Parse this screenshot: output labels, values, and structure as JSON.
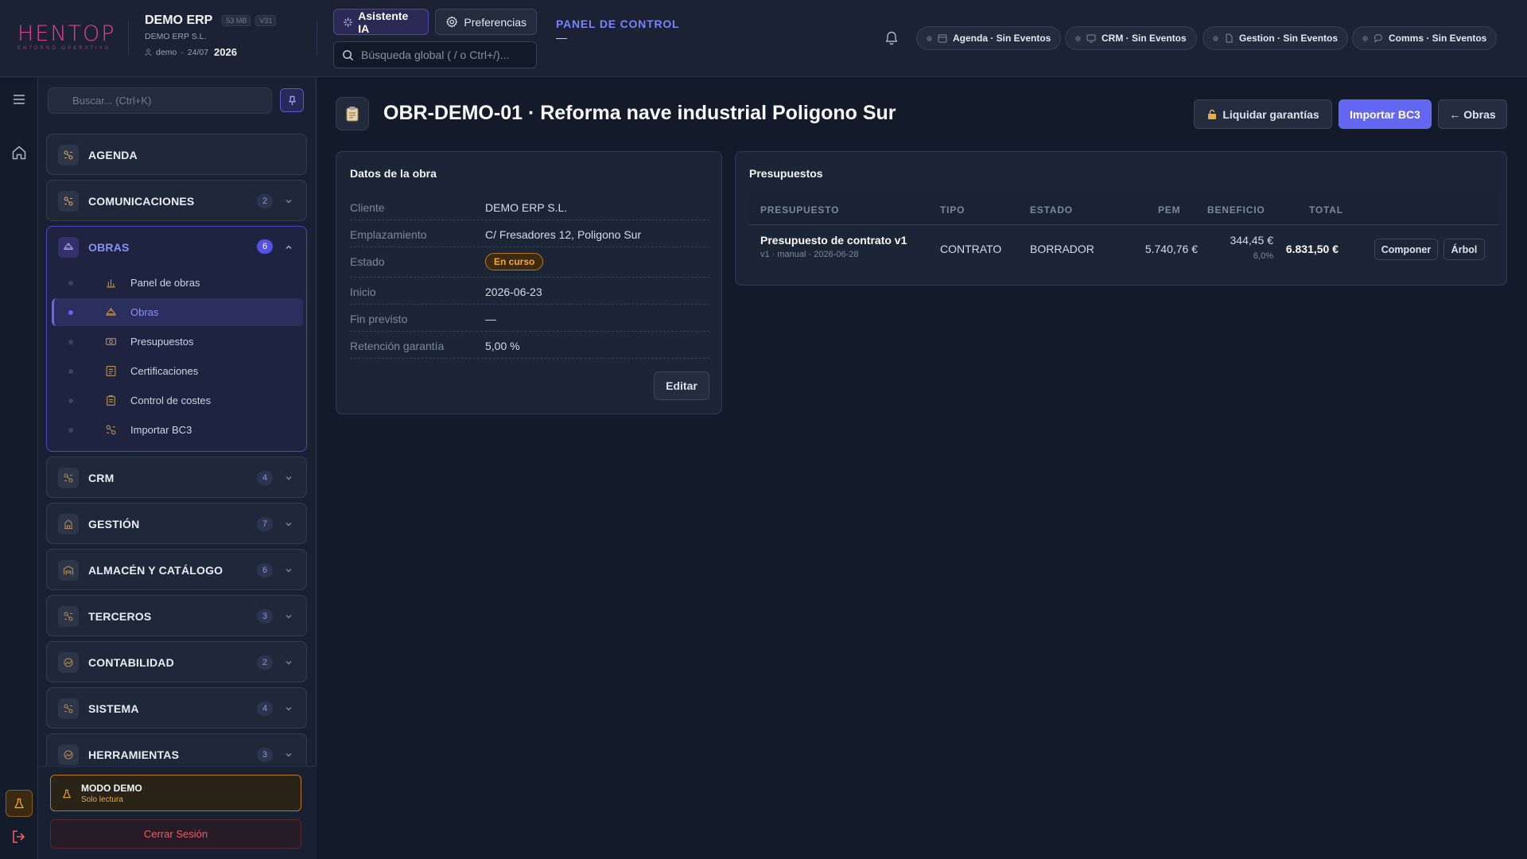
{
  "header": {
    "logo_text": "HENTOP",
    "logo_sub": "ENTORNO OPERATIVO",
    "company_name": "DEMO ERP",
    "size_badge": "53 MB",
    "version_badge": "V31",
    "company_legal": "DEMO ERP S.L.",
    "user": "demo",
    "date": "24/07",
    "year": "2026",
    "ai_button": "Asistente IA",
    "prefs_button": "Preferencias",
    "search_placeholder": "Búsqueda global ( / o Ctrl+/)...",
    "panel_title": "PANEL DE CONTROL",
    "panel_sub": "—",
    "status_pills": [
      {
        "label": "Agenda · Sin Eventos",
        "icon": "calendar-icon"
      },
      {
        "label": "CRM · Sin Eventos",
        "icon": "monitor-icon"
      },
      {
        "label": "Gestion · Sin Eventos",
        "icon": "document-icon"
      },
      {
        "label": "Comms · Sin Eventos",
        "icon": "chat-icon"
      }
    ]
  },
  "sidebar": {
    "search_placeholder": "Buscar... (Ctrl+K)",
    "groups": [
      {
        "label": "AGENDA",
        "count": ""
      },
      {
        "label": "COMUNICACIONES",
        "count": "2"
      },
      {
        "label": "OBRAS",
        "count": "6",
        "open": true
      },
      {
        "label": "CRM",
        "count": "4"
      },
      {
        "label": "GESTIÓN",
        "count": "7"
      },
      {
        "label": "ALMACÉN Y CATÁLOGO",
        "count": "6"
      },
      {
        "label": "TERCEROS",
        "count": "3"
      },
      {
        "label": "CONTABILIDAD",
        "count": "2"
      },
      {
        "label": "SISTEMA",
        "count": "4"
      },
      {
        "label": "HERRAMIENTAS",
        "count": "3"
      }
    ],
    "obras_items": [
      {
        "label": "Panel de obras"
      },
      {
        "label": "Obras",
        "active": true
      },
      {
        "label": "Presupuestos"
      },
      {
        "label": "Certificaciones"
      },
      {
        "label": "Control de costes"
      },
      {
        "label": "Importar BC3"
      }
    ],
    "demo_title": "MODO DEMO",
    "demo_sub": "Solo lectura",
    "logout": "Cerrar Sesión"
  },
  "page": {
    "title": "OBR-DEMO-01 · Reforma nave industrial Poligono Sur",
    "btn_liquidar": "Liquidar garantías",
    "btn_importar": "Importar BC3",
    "btn_back": "← Obras"
  },
  "datos": {
    "title": "Datos de la obra",
    "rows": [
      {
        "k": "Cliente",
        "v": "DEMO ERP S.L."
      },
      {
        "k": "Emplazamiento",
        "v": "C/ Fresadores 12, Poligono Sur"
      },
      {
        "k": "Estado",
        "v": "En curso"
      },
      {
        "k": "Inicio",
        "v": "2026-06-23"
      },
      {
        "k": "Fin previsto",
        "v": "—"
      },
      {
        "k": "Retención garantía",
        "v": "5,00 %"
      }
    ],
    "edit": "Editar"
  },
  "presupuestos": {
    "title": "Presupuestos",
    "columns": [
      "PRESUPUESTO",
      "TIPO",
      "ESTADO",
      "PEM",
      "BENEFICIO",
      "TOTAL"
    ],
    "rows": [
      {
        "name": "Presupuesto de contrato v1",
        "meta": "v1 · manual · 2026-06-28",
        "tipo": "CONTRATO",
        "estado": "BORRADOR",
        "pem": "5.740,76 €",
        "beneficio": "344,45 €",
        "beneficio_pct": "6,0%",
        "total": "6.831,50 €",
        "btn_componer": "Componer",
        "btn_arbol": "Árbol"
      }
    ]
  },
  "colors": {
    "accent": "#6366f1",
    "brand": "#e0409a",
    "warning": "#f2a93b",
    "danger": "#f05a6a"
  }
}
